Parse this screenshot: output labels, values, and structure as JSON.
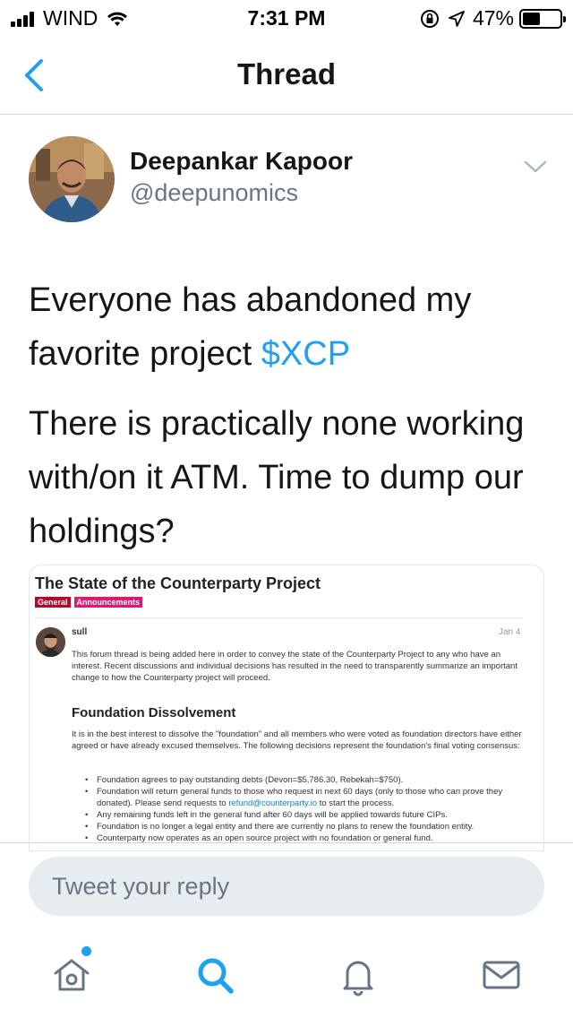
{
  "status_bar": {
    "carrier": "WIND",
    "time": "7:31 PM",
    "battery": "47%",
    "battery_level": 0.47
  },
  "nav": {
    "title": "Thread",
    "back_icon": "chevron-left-icon"
  },
  "tweet": {
    "author_name": "Deepankar Kapoor",
    "author_handle": "@deepunomics",
    "paragraph1_text": "Everyone has abandoned my favorite project ",
    "paragraph1_cashtag": "$XCP",
    "paragraph2_text": "There is practically none working with/on it ATM. Time to dump our holdings?"
  },
  "media": {
    "title": "The State of the Counterparty Project",
    "tags": [
      "General",
      "Announcements"
    ],
    "user": "sull",
    "date": "Jan 4",
    "intro": "This forum thread is being added here in order to convey the state of the Counterparty Project to any who have an interest. Recent discussions and individual decisions has resulted in the need to transparently summarize an important change to how the Counterparty project will proceed.",
    "heading": "Foundation Dissolvement",
    "body": "It is in the best interest to dissolve the \"foundation\" and all members who were voted as foundation directors have either agreed or have already excused themselves. The following decisions represent the foundation's final voting consensus:",
    "list": [
      "Foundation agrees to pay outstanding debts (Devon=$5,786.30, Rebekah=$750).",
      "Foundation will return general funds to those who request in next 60 days (only to those who can prove they donated). Please send requests to ",
      "Any remaining funds left in the general fund after 60 days will be applied towards future CIPs.",
      "Foundation is no longer a legal entity and there are currently no plans to renew the foundation entity.",
      "Counterparty now operates as an open source project with no foundation or general fund."
    ],
    "refund_link": "refund@counterparty.io",
    "refund_suffix": " to start the process."
  },
  "reply": {
    "placeholder": "Tweet your reply"
  },
  "tabbar": {
    "icons": [
      "home-icon",
      "search-icon",
      "notifications-icon",
      "messages-icon"
    ]
  },
  "colors": {
    "accent": "#1da1f2",
    "text": "#14171a",
    "muted": "#657786"
  }
}
